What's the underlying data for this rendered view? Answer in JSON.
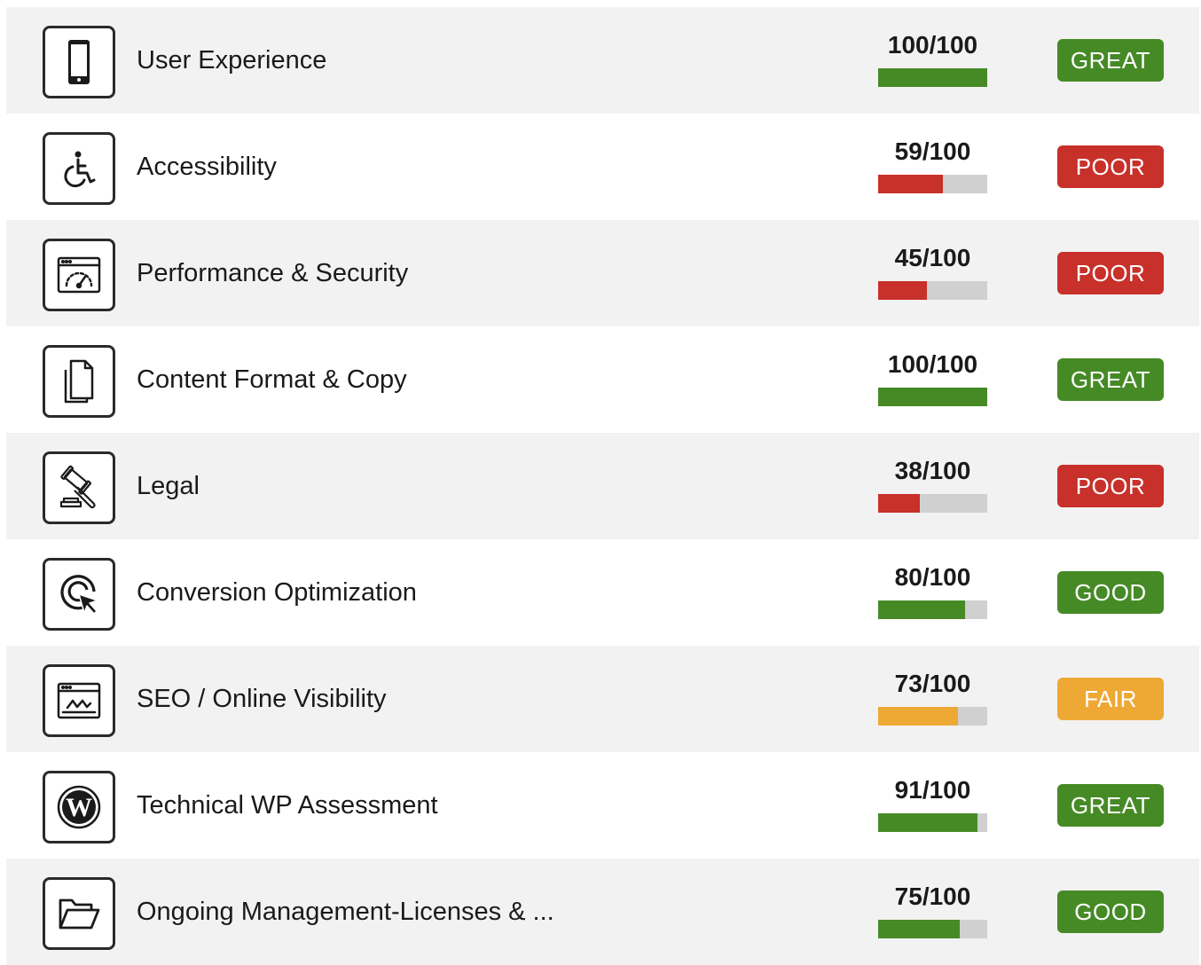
{
  "colors": {
    "great": "#468a26",
    "good": "#468a26",
    "poor": "#c8302a",
    "fair": "#eea834",
    "bar_track": "#d0d0d0",
    "row_shade": "#f2f2f2"
  },
  "rows": [
    {
      "label": "User Experience",
      "score_text": "100/100",
      "score": 100,
      "rating": "GREAT",
      "status": "great",
      "icon": "mobile-phone-icon"
    },
    {
      "label": "Accessibility",
      "score_text": "59/100",
      "score": 59,
      "rating": "POOR",
      "status": "poor",
      "icon": "wheelchair-icon"
    },
    {
      "label": "Performance & Security",
      "score_text": "45/100",
      "score": 45,
      "rating": "POOR",
      "status": "poor",
      "icon": "speedometer-browser-icon"
    },
    {
      "label": "Content Format & Copy",
      "score_text": "100/100",
      "score": 100,
      "rating": "GREAT",
      "status": "great",
      "icon": "documents-copy-icon"
    },
    {
      "label": "Legal",
      "score_text": "38/100",
      "score": 38,
      "rating": "POOR",
      "status": "poor",
      "icon": "gavel-icon"
    },
    {
      "label": "Conversion Optimization",
      "score_text": "80/100",
      "score": 80,
      "rating": "GOOD",
      "status": "good",
      "icon": "target-cursor-icon"
    },
    {
      "label": "SEO / Online Visibility",
      "score_text": "73/100",
      "score": 73,
      "rating": "FAIR",
      "status": "fair",
      "icon": "browser-chart-icon"
    },
    {
      "label": "Technical WP Assessment",
      "score_text": "91/100",
      "score": 91,
      "rating": "GREAT",
      "status": "great",
      "icon": "wordpress-icon"
    },
    {
      "label": "Ongoing Management-Licenses & ...",
      "score_text": "75/100",
      "score": 75,
      "rating": "GOOD",
      "status": "good",
      "icon": "open-folder-icon"
    }
  ]
}
